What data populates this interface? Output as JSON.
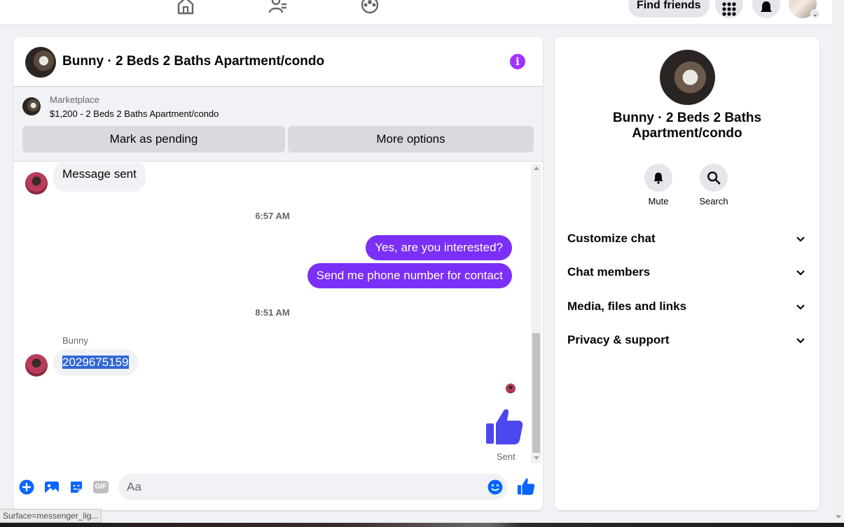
{
  "topbar": {
    "find_friends_label": "Find friends"
  },
  "chat": {
    "header_title": "Bunny · 2 Beds 2 Baths Apartment/condo",
    "listing": {
      "source": "Marketplace",
      "price_title": "$1,200 - 2 Beds 2 Baths Apartment/condo",
      "mark_pending_label": "Mark as pending",
      "more_options_label": "More options"
    },
    "messages": {
      "msg1": "Message sent",
      "time1": "6:57 AM",
      "msg2": "Yes, are you interested?",
      "msg3": "Send me phone number for contact",
      "time2": "8:51 AM",
      "sender_name": "Bunny",
      "msg4": "2029675159",
      "status": "Sent"
    },
    "composer": {
      "placeholder": "Aa",
      "gif_label": "GIF"
    }
  },
  "details": {
    "title": "Bunny · 2 Beds 2 Baths Apartment/condo",
    "actions": [
      {
        "label": "Mute"
      },
      {
        "label": "Search"
      }
    ],
    "sections": [
      {
        "label": "Customize chat"
      },
      {
        "label": "Chat members"
      },
      {
        "label": "Media, files and links"
      },
      {
        "label": "Privacy & support"
      }
    ]
  },
  "status_bar": {
    "text": "Surface=messenger_lig..."
  },
  "colors": {
    "accent": "#7b2ff7",
    "facebook_blue": "#0866ff",
    "info_purple": "#a033ff",
    "like_blue": "#4d47f0"
  }
}
